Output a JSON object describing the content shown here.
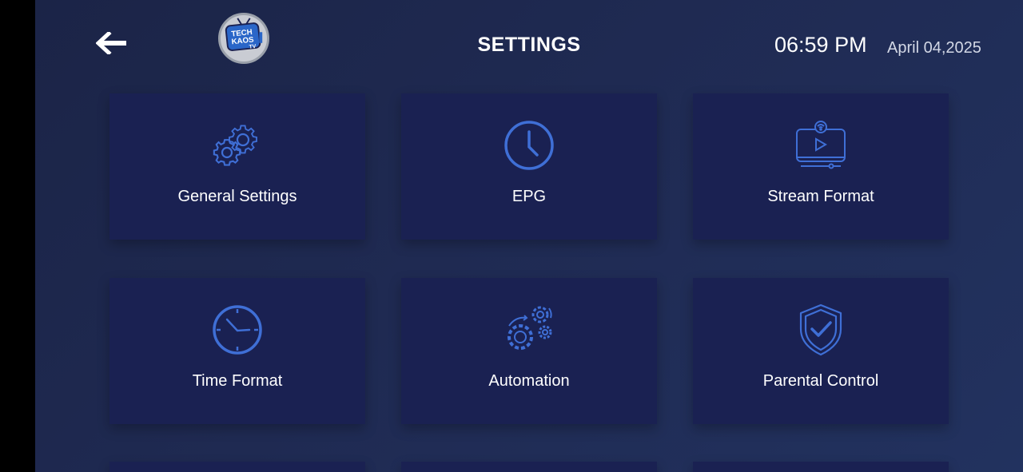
{
  "header": {
    "back_icon": "arrow-left-icon",
    "logo_text_line1": "TECH",
    "logo_text_line2": "KAOS",
    "logo_text_line3": "TV",
    "title": "SETTINGS",
    "time": "06:59 PM",
    "date": "April 04,2025"
  },
  "tiles": [
    {
      "label": "General Settings",
      "icon": "gears-icon"
    },
    {
      "label": "EPG",
      "icon": "clock-icon"
    },
    {
      "label": "Stream Format",
      "icon": "monitor-play-icon"
    },
    {
      "label": "Time Format",
      "icon": "time-icon"
    },
    {
      "label": "Automation",
      "icon": "automation-gears-icon"
    },
    {
      "label": "Parental Control",
      "icon": "shield-check-icon"
    }
  ],
  "colors": {
    "accent": "#3f6fd6",
    "tile_bg": "#1a2152",
    "screen_bg": "#1f2a52"
  }
}
